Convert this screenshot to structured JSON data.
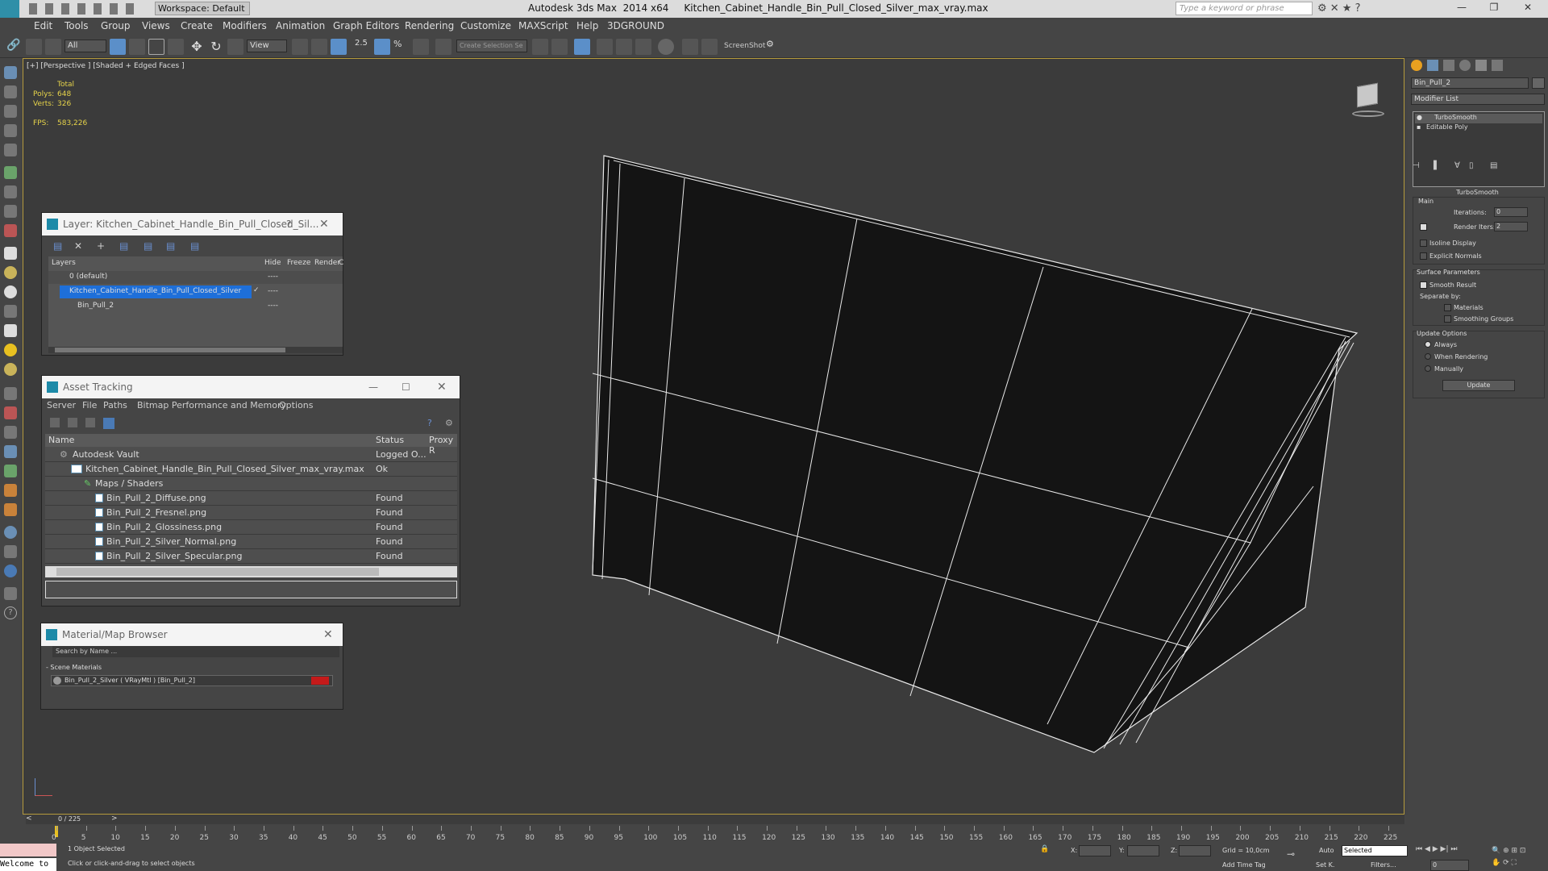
{
  "app": {
    "title": "Autodesk 3ds Max  2014 x64     Kitchen_Cabinet_Handle_Bin_Pull_Closed_Silver_max_vray.max",
    "workspace": "Workspace: Default",
    "search_placeholder": "Type a keyword or phrase"
  },
  "menu": [
    "Edit",
    "Tools",
    "Group",
    "Views",
    "Create",
    "Modifiers",
    "Animation",
    "Graph Editors",
    "Rendering",
    "Customize",
    "MAXScript",
    "Help",
    "3DGROUND"
  ],
  "toolbar": {
    "filter": "All",
    "view": "View",
    "selection_set": "Create Selection Se",
    "screenshot": "ScreenShot"
  },
  "viewport": {
    "label": "[+] [Perspective ] [Shaded + Edged Faces ]",
    "stats": {
      "total": "Total",
      "polys_label": "Polys:",
      "polys": "648",
      "verts_label": "Verts:",
      "verts": "326",
      "fps_label": "FPS:",
      "fps": "583,226"
    }
  },
  "layer_window": {
    "title": "Layer: Kitchen_Cabinet_Handle_Bin_Pull_Closed_Sil...",
    "help": "?",
    "cols": [
      "Layers",
      "Hide",
      "Freeze",
      "Render",
      "C"
    ],
    "rows": [
      {
        "name": "0 (default)",
        "state": "----"
      },
      {
        "name": "Kitchen_Cabinet_Handle_Bin_Pull_Closed_Silver",
        "state": "----"
      },
      {
        "name": "Bin_Pull_2",
        "state": "----"
      }
    ]
  },
  "asset_window": {
    "title": "Asset Tracking",
    "menu": [
      "Server",
      "File",
      "Paths",
      "Bitmap Performance and Memory",
      "Options"
    ],
    "cols": [
      "Name",
      "Status",
      "Proxy R"
    ],
    "rows": [
      {
        "name": "Autodesk Vault",
        "status": "Logged O..."
      },
      {
        "name": "Kitchen_Cabinet_Handle_Bin_Pull_Closed_Silver_max_vray.max",
        "status": "Ok"
      },
      {
        "name": "Maps / Shaders",
        "status": ""
      },
      {
        "name": "Bin_Pull_2_Diffuse.png",
        "status": "Found"
      },
      {
        "name": "Bin_Pull_2_Fresnel.png",
        "status": "Found"
      },
      {
        "name": "Bin_Pull_2_Glossiness.png",
        "status": "Found"
      },
      {
        "name": "Bin_Pull_2_Silver_Normal.png",
        "status": "Found"
      },
      {
        "name": "Bin_Pull_2_Silver_Specular.png",
        "status": "Found"
      }
    ]
  },
  "material_window": {
    "title": "Material/Map Browser",
    "search": "Search by Name ...",
    "section": "- Scene Materials",
    "item": "Bin_Pull_2_Silver  ( VRayMtl ) [Bin_Pull_2]"
  },
  "command_panel": {
    "object_name": "Bin_Pull_2",
    "modifier_list": "Modifier List",
    "stack": [
      "TurboSmooth",
      "Editable Poly"
    ],
    "rollout": "TurboSmooth",
    "main": "Main",
    "iterations_label": "Iterations:",
    "iterations": "0",
    "render_iters_label": "Render Iters:",
    "render_iters": "2",
    "isoline": "Isoline Display",
    "explicit": "Explicit Normals",
    "surface": "Surface Parameters",
    "smooth": "Smooth Result",
    "separate": "Separate by:",
    "materials": "Materials",
    "smoothing": "Smoothing Groups",
    "update_options": "Update Options",
    "always": "Always",
    "when_rendering": "When Rendering",
    "manually": "Manually",
    "update": "Update"
  },
  "timeline": {
    "frame": "0 / 225",
    "ticks": [
      "0",
      "5",
      "10",
      "15",
      "20",
      "25",
      "30",
      "35",
      "40",
      "45",
      "50",
      "55",
      "60",
      "65",
      "70",
      "75",
      "80",
      "85",
      "90",
      "95",
      "100",
      "105",
      "110",
      "115",
      "120",
      "125",
      "130",
      "135",
      "140",
      "145",
      "150",
      "155",
      "160",
      "165",
      "170",
      "175",
      "180",
      "185",
      "190",
      "195",
      "200",
      "205",
      "210",
      "215",
      "220",
      "225"
    ]
  },
  "status": {
    "welcome": "Welcome to",
    "selected": "1 Object Selected",
    "hint": "Click or click-and-drag to select objects",
    "x": "X:",
    "y": "Y:",
    "z": "Z:",
    "grid": "Grid = 10,0cm",
    "add_time_tag": "Add Time Tag",
    "auto": "Auto",
    "set_key": "Set K.",
    "selected_dd": "Selected",
    "filters": "Filters...",
    "frame_field": "0"
  }
}
